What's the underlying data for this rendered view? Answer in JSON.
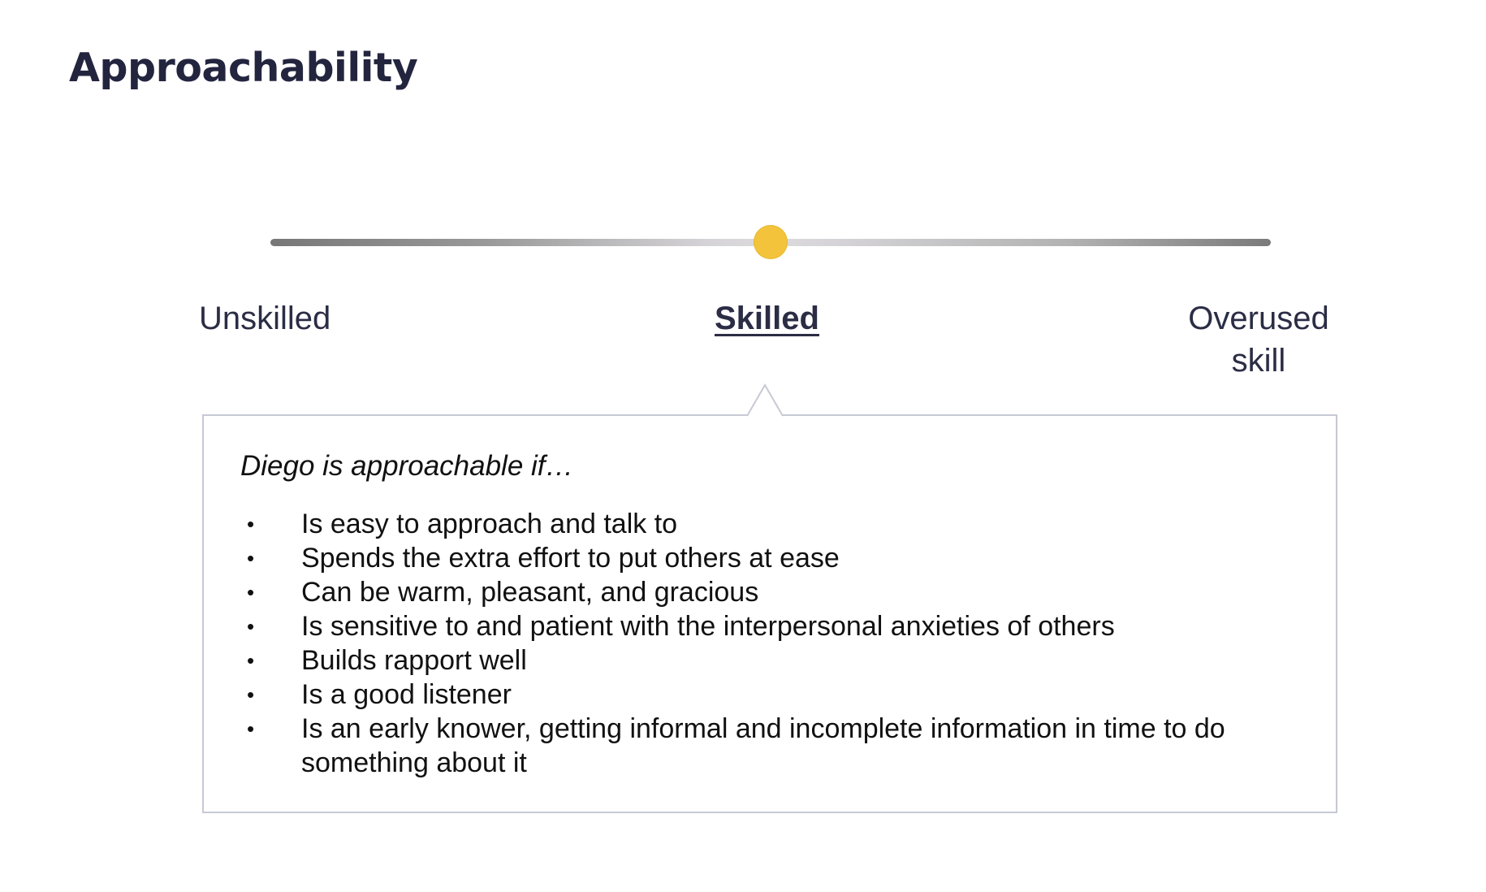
{
  "page": {
    "title": "Approachability"
  },
  "slider": {
    "selected_level": "Skilled",
    "selected_position_fraction": 0.5,
    "knob_color": "#f3c33c",
    "levels": [
      {
        "label": "Unskilled"
      },
      {
        "label": "Skilled"
      },
      {
        "label": "Overused skill"
      }
    ]
  },
  "description": {
    "intro": "Diego is approachable if…",
    "bullet_char": "•",
    "items": [
      "Is easy to approach and talk to",
      "Spends the extra effort to put others at ease",
      "Can be warm, pleasant, and gracious",
      "Is sensitive to and patient with the interpersonal anxieties of others",
      "Builds rapport well",
      "Is a good listener",
      "Is an early knower, getting informal and incomplete information in time to do something about it"
    ]
  }
}
